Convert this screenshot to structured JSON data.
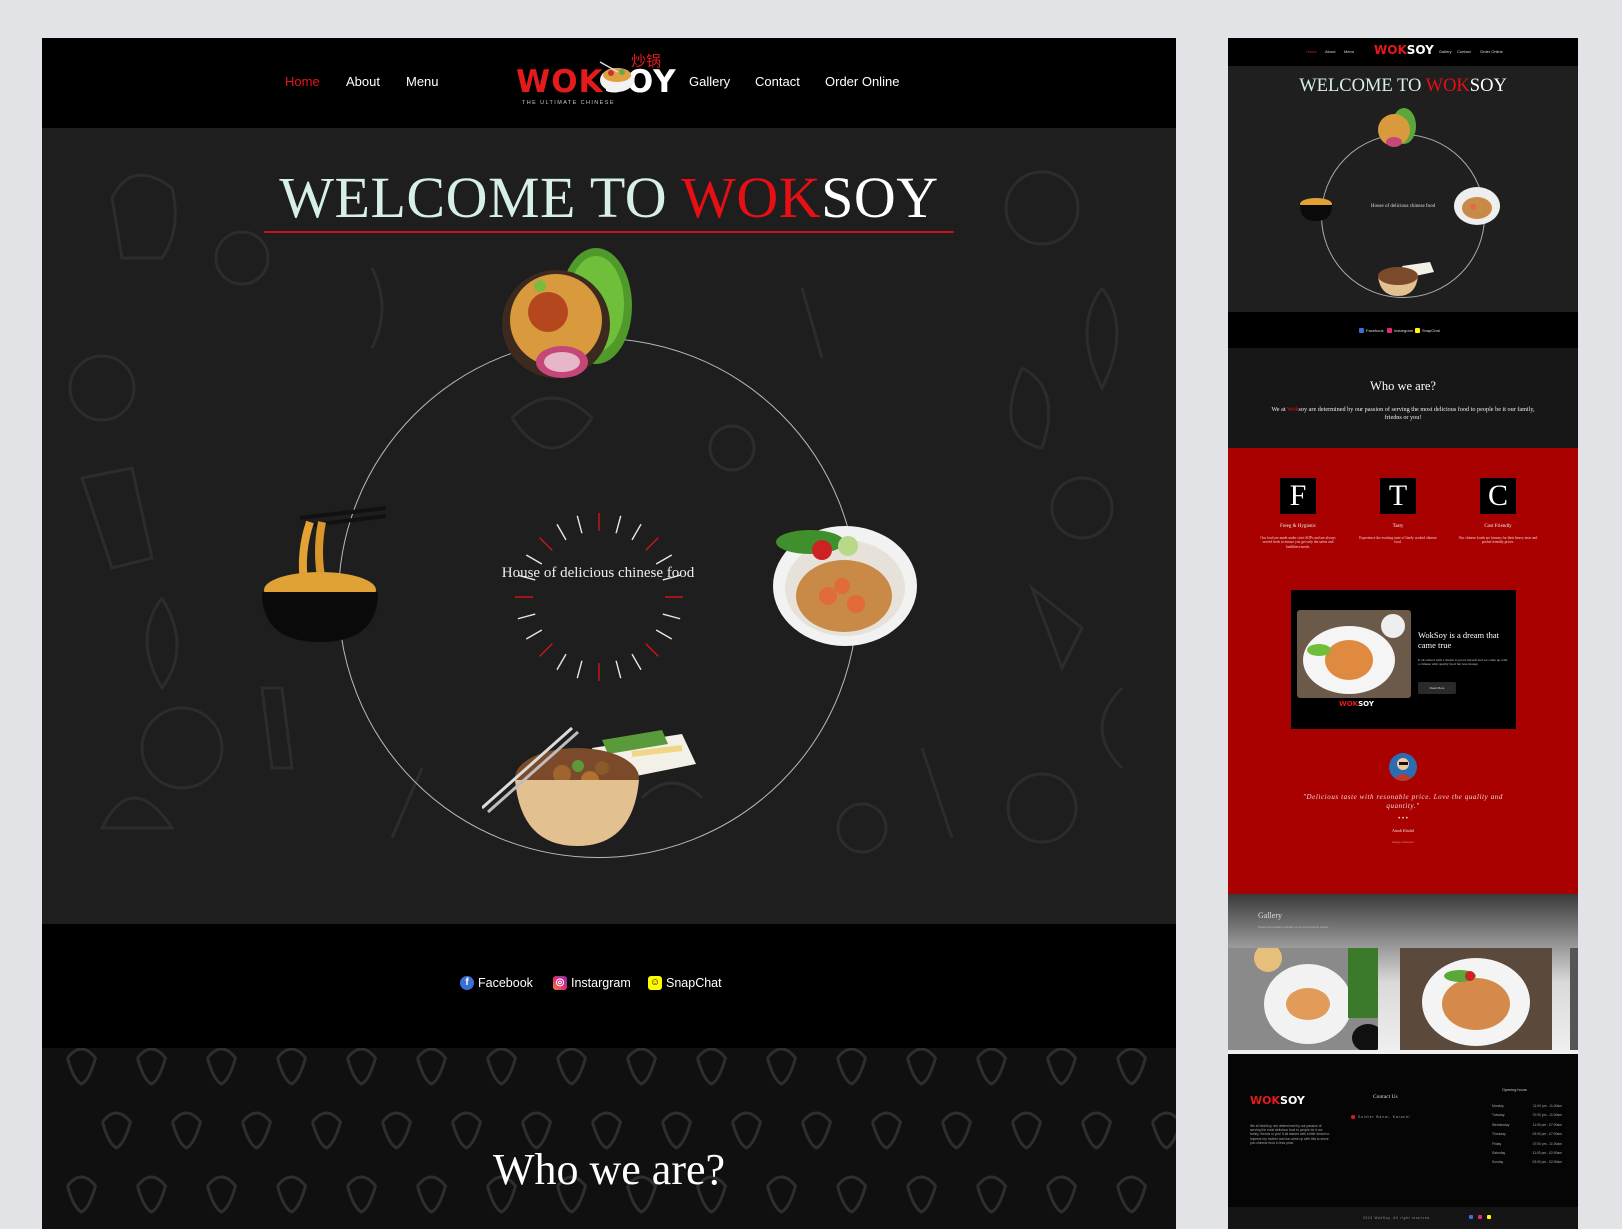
{
  "nav": {
    "items": [
      "Home",
      "About",
      "Menu",
      "Gallery",
      "Contact",
      "Order Online"
    ],
    "active": "Home"
  },
  "logo": {
    "wok": "WOK",
    "soy": "SOY",
    "chinese": "炒锅",
    "tagline": "THE ULTIMATE CHINESE"
  },
  "hero": {
    "welcome_prefix": "WELCOME TO ",
    "welcome_brand_red": "WOK",
    "welcome_brand_white": "SOY",
    "center_text": "House of delicious chinese food"
  },
  "social": {
    "facebook": "Facebook",
    "instagram": "Instargram",
    "snapchat": "SnapChat"
  },
  "who": {
    "title": "Who we are?"
  },
  "mini": {
    "who_text_pre": "We at ",
    "who_text_brand": "Wok",
    "who_text_post": "soy are determined by our passion of serving the most delicious food to people be it our family, friedns or you!",
    "features": [
      {
        "letter": "F",
        "title": "Freeg & Hygienic",
        "desc": "Our food are made under strict SOPs and are always served fresh to ensure you get only the safest and healthiest meals."
      },
      {
        "letter": "T",
        "title": "Tasty",
        "desc": "Experience the exciting taste of finely cooked chinese food."
      },
      {
        "letter": "C",
        "title": "Cost Friendly",
        "desc": "Our chinese foods are famous for their heavy taste and pocket friendly prices."
      }
    ],
    "dream": {
      "title": "WokSoy is a dream that came true",
      "text": "It all started with a dream to prove myself and we came up with a chinese with quality food but less money.",
      "button": "Read More"
    },
    "testimonial": {
      "quote": "\"Delicious taste with resonable price. Love  the quality and quantity.\"",
      "dots": "• • •",
      "name": "Amoh Khalid",
      "role": "Happy customer"
    },
    "gallery": {
      "title": "Gallery",
      "subtitle": "Check out pleasing visuals of our scrumptious meals."
    },
    "footer": {
      "about": "We at WokSoy, are determined by our passion of serving the most delicious food to people be it our family, friends or you! It all started with a little dream to impress my mother and we came up with this to serve you chinese food in less price.",
      "contact_title": "Contact Us",
      "address": "Soldier Bazar, Karachi",
      "hours_title": "Opening hours",
      "hours": [
        [
          "Monday",
          "11:00 pm - 11:00am"
        ],
        [
          "Tuesday",
          "07:00 pm - 11:00am"
        ],
        [
          "Wednesday",
          "11:00 pm - 07:00am"
        ],
        [
          "Thursday",
          "03:00 pm - 07:00am"
        ],
        [
          "Friday",
          "07:00 pm - 11:00am"
        ],
        [
          "Saturday",
          "11:00 pm - 02:00am"
        ],
        [
          "Sunday",
          "03:00 pm - 02:00am"
        ]
      ],
      "copyright": "2023 WokSoy. All right reserved."
    }
  },
  "colors": {
    "accent_red": "#e50f14",
    "panel_red": "#a90000",
    "hero_bg": "#1e1e1f"
  }
}
